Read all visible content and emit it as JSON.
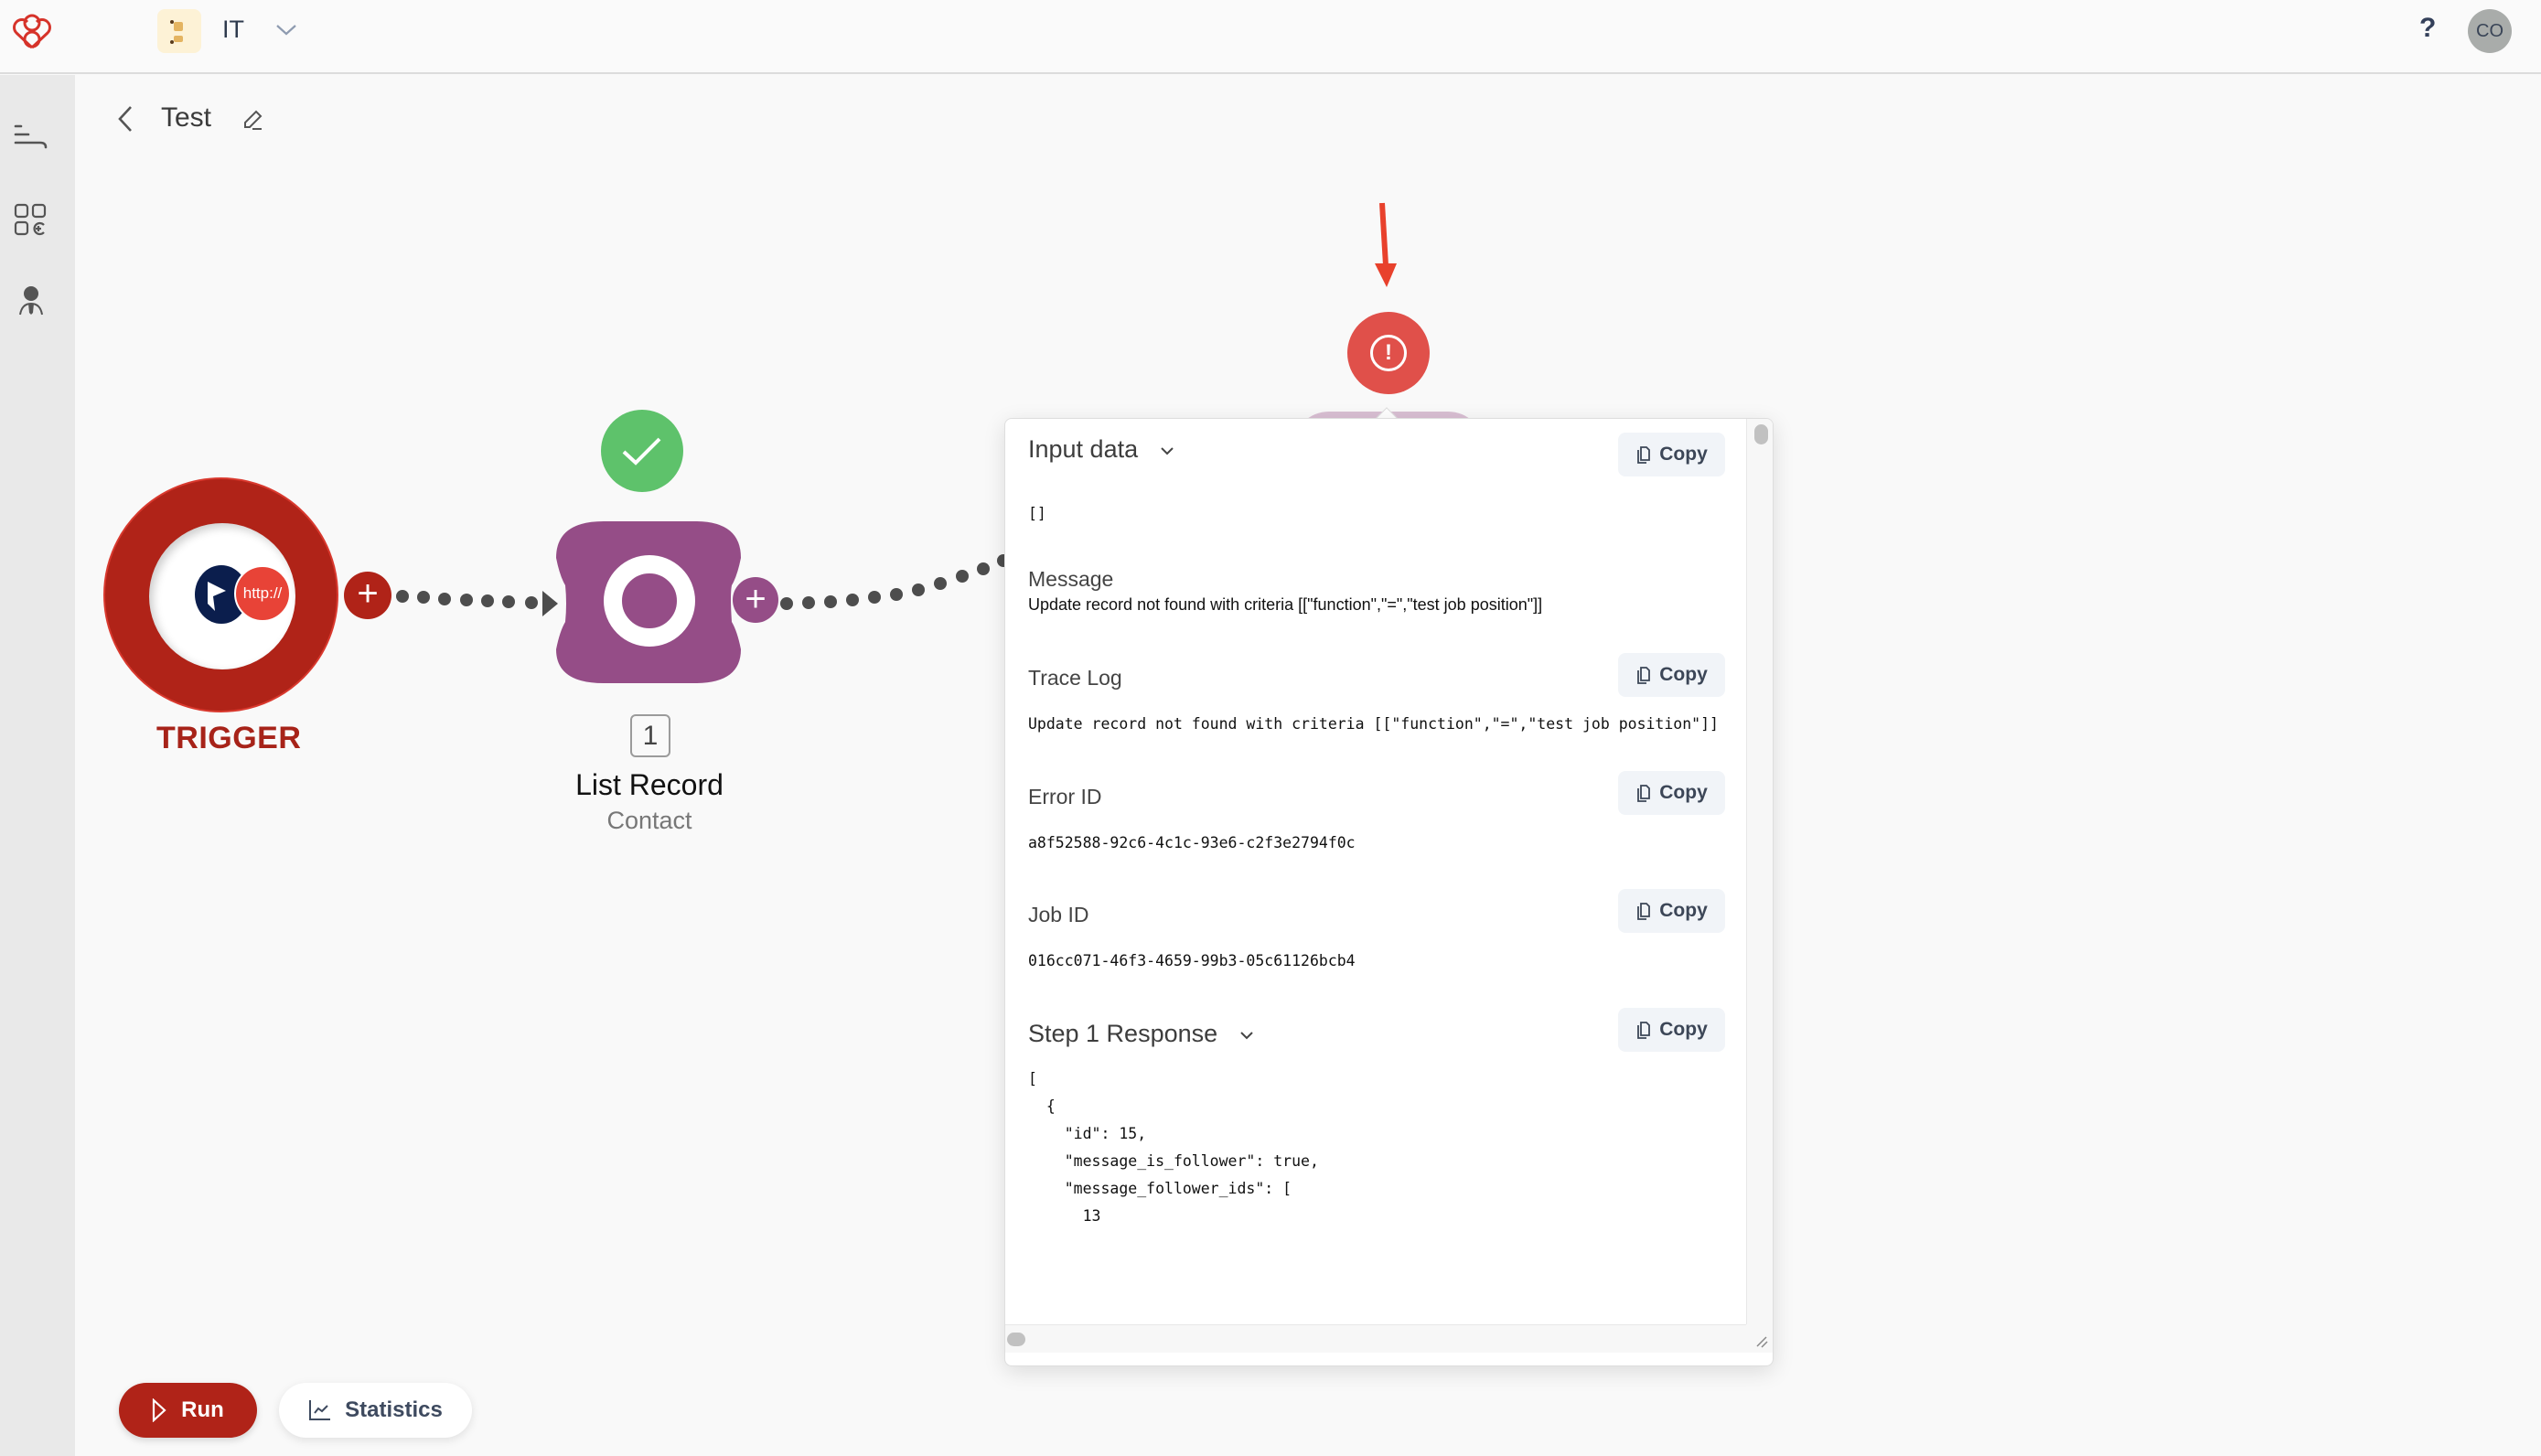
{
  "header": {
    "workspace_name": "IT",
    "help_label": "?",
    "avatar_initials": "CO"
  },
  "sidebar": {
    "items": [
      {
        "icon": "flows-icon"
      },
      {
        "icon": "apps-add-icon"
      },
      {
        "icon": "user-icon"
      }
    ]
  },
  "flow": {
    "title": "Test"
  },
  "canvas": {
    "trigger": {
      "label": "TRIGGER",
      "http_label": "http://"
    },
    "module": {
      "step": "1",
      "name": "List Record",
      "subtitle": "Contact",
      "status": "success"
    },
    "error_node": {
      "status": "error",
      "icon": "!"
    },
    "colors": {
      "trigger": "#b02318",
      "module": "#954d87",
      "success": "#5ec26b",
      "error": "#e0504a",
      "annotation": "#e8412c"
    }
  },
  "panel": {
    "sections": [
      {
        "title": "Input data",
        "copy": "Copy",
        "content": "[]"
      },
      {
        "title": "Message",
        "content": "Update record not found with criteria [[\"function\",\"=\",\"test job position\"]]"
      },
      {
        "title": "Trace Log",
        "copy": "Copy",
        "content": "Update record not found with criteria [[\"function\",\"=\",\"test job position\"]]"
      },
      {
        "title": "Error ID",
        "copy": "Copy",
        "content": "a8f52588-92c6-4c1c-93e6-c2f3e2794f0c"
      },
      {
        "title": "Job ID",
        "copy": "Copy",
        "content": "016cc071-46f3-4659-99b3-05c61126bcb4"
      },
      {
        "title": "Step 1 Response",
        "copy": "Copy"
      }
    ],
    "response_lines": [
      "[",
      "  {",
      "    \"id\": 15,",
      "    \"message_is_follower\": true,",
      "    \"message_follower_ids\": [",
      "      13"
    ]
  },
  "footer": {
    "run_label": "Run",
    "statistics_label": "Statistics"
  }
}
